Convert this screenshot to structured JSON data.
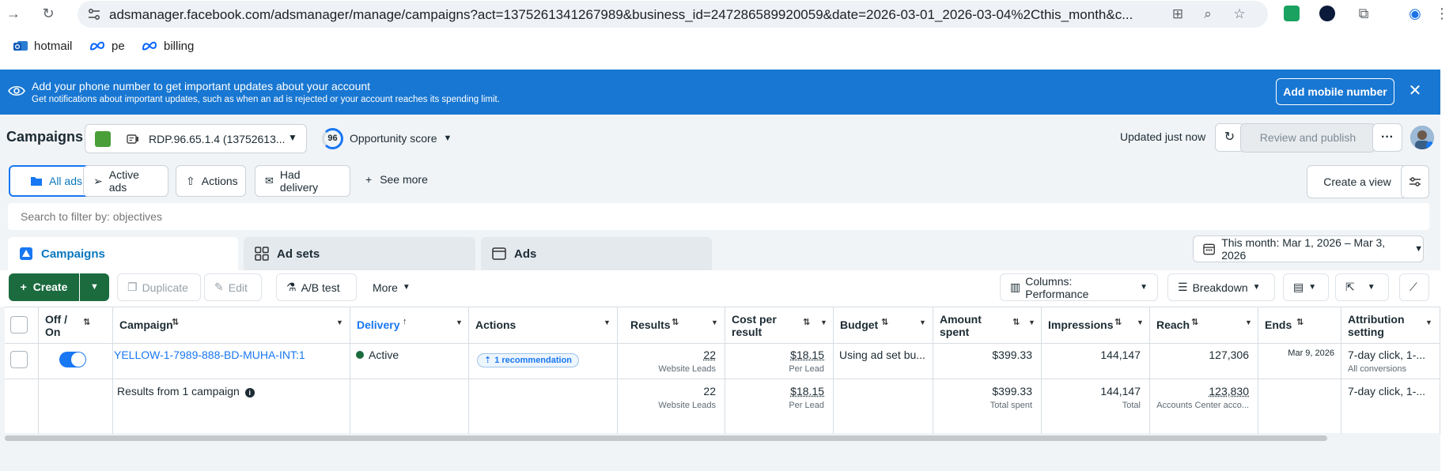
{
  "browser": {
    "url": "adsmanager.facebook.com/adsmanager/manage/campaigns?act=1375261341267989&business_id=247286589920059&date=2026-03-01_2026-03-04%2Cthis_month&c...",
    "bookmarks": [
      {
        "label": "hotmail",
        "icon": "outlook-icon"
      },
      {
        "label": "pe",
        "icon": "meta-icon"
      },
      {
        "label": "billing",
        "icon": "meta-icon"
      }
    ]
  },
  "banner": {
    "title": "Add your phone number to get important updates about your account",
    "subtitle": "Get notifications about important updates, such as when an ad is rejected or your account reaches its spending limit.",
    "button": "Add mobile number",
    "close": "✕"
  },
  "header": {
    "title": "Campaigns",
    "account": "RDP.96.65.1.4 (13752613...",
    "opportunity_score": "96",
    "opportunity_label": "Opportunity score",
    "updated": "Updated just now",
    "review_publish": "Review and publish"
  },
  "filters": {
    "chips": [
      "All ads",
      "Active ads",
      "Actions",
      "Had delivery"
    ],
    "see_more": "See more",
    "create_view": "Create a view",
    "search_placeholder": "Search to filter by: objectives"
  },
  "levels": {
    "tabs": [
      "Campaigns",
      "Ad sets",
      "Ads"
    ],
    "date_range": "This month: Mar 1, 2026 – Mar 3, 2026"
  },
  "toolbar": {
    "create": "Create",
    "duplicate": "Duplicate",
    "edit": "Edit",
    "ab_test": "A/B test",
    "more": "More",
    "columns": "Columns: Performance",
    "breakdown": "Breakdown"
  },
  "table": {
    "headers": {
      "off_on": "Off / On",
      "campaign": "Campaign",
      "delivery": "Delivery",
      "actions": "Actions",
      "results": "Results",
      "cost_per_result_1": "Cost per",
      "cost_per_result_2": "result",
      "budget": "Budget",
      "amount_spent_1": "Amount",
      "amount_spent_2": "spent",
      "impressions": "Impressions",
      "reach": "Reach",
      "ends": "Ends",
      "attribution_1": "Attribution",
      "attribution_2": "setting"
    },
    "row": {
      "campaign": "YELLOW-1-7989-888-BD-MUHA-INT:1",
      "delivery": "Active",
      "recommendation": "1 recommendation",
      "results": "22",
      "results_sub": "Website Leads",
      "cost": "$18.15",
      "cost_sub": "Per Lead",
      "budget": "Using ad set bu...",
      "spent": "$399.33",
      "impressions": "144,147",
      "reach": "127,306",
      "ends": "Mar 9, 2026",
      "attribution": "7-day click, 1-...",
      "attribution_sub": "All conversions",
      "toggle_on": true
    },
    "summary": {
      "label": "Results from 1 campaign",
      "results": "22",
      "results_sub": "Website Leads",
      "cost": "$18.15",
      "cost_sub": "Per Lead",
      "spent": "$399.33",
      "spent_sub": "Total spent",
      "impressions": "144,147",
      "impressions_sub": "Total",
      "reach": "123,830",
      "reach_sub": "Accounts Center acco...",
      "attribution": "7-day click, 1-..."
    }
  },
  "colors": {
    "banner": "#1877d2",
    "create": "#1b6b3f",
    "accent": "#1877f2",
    "active_dot": "#1b6b3f"
  }
}
